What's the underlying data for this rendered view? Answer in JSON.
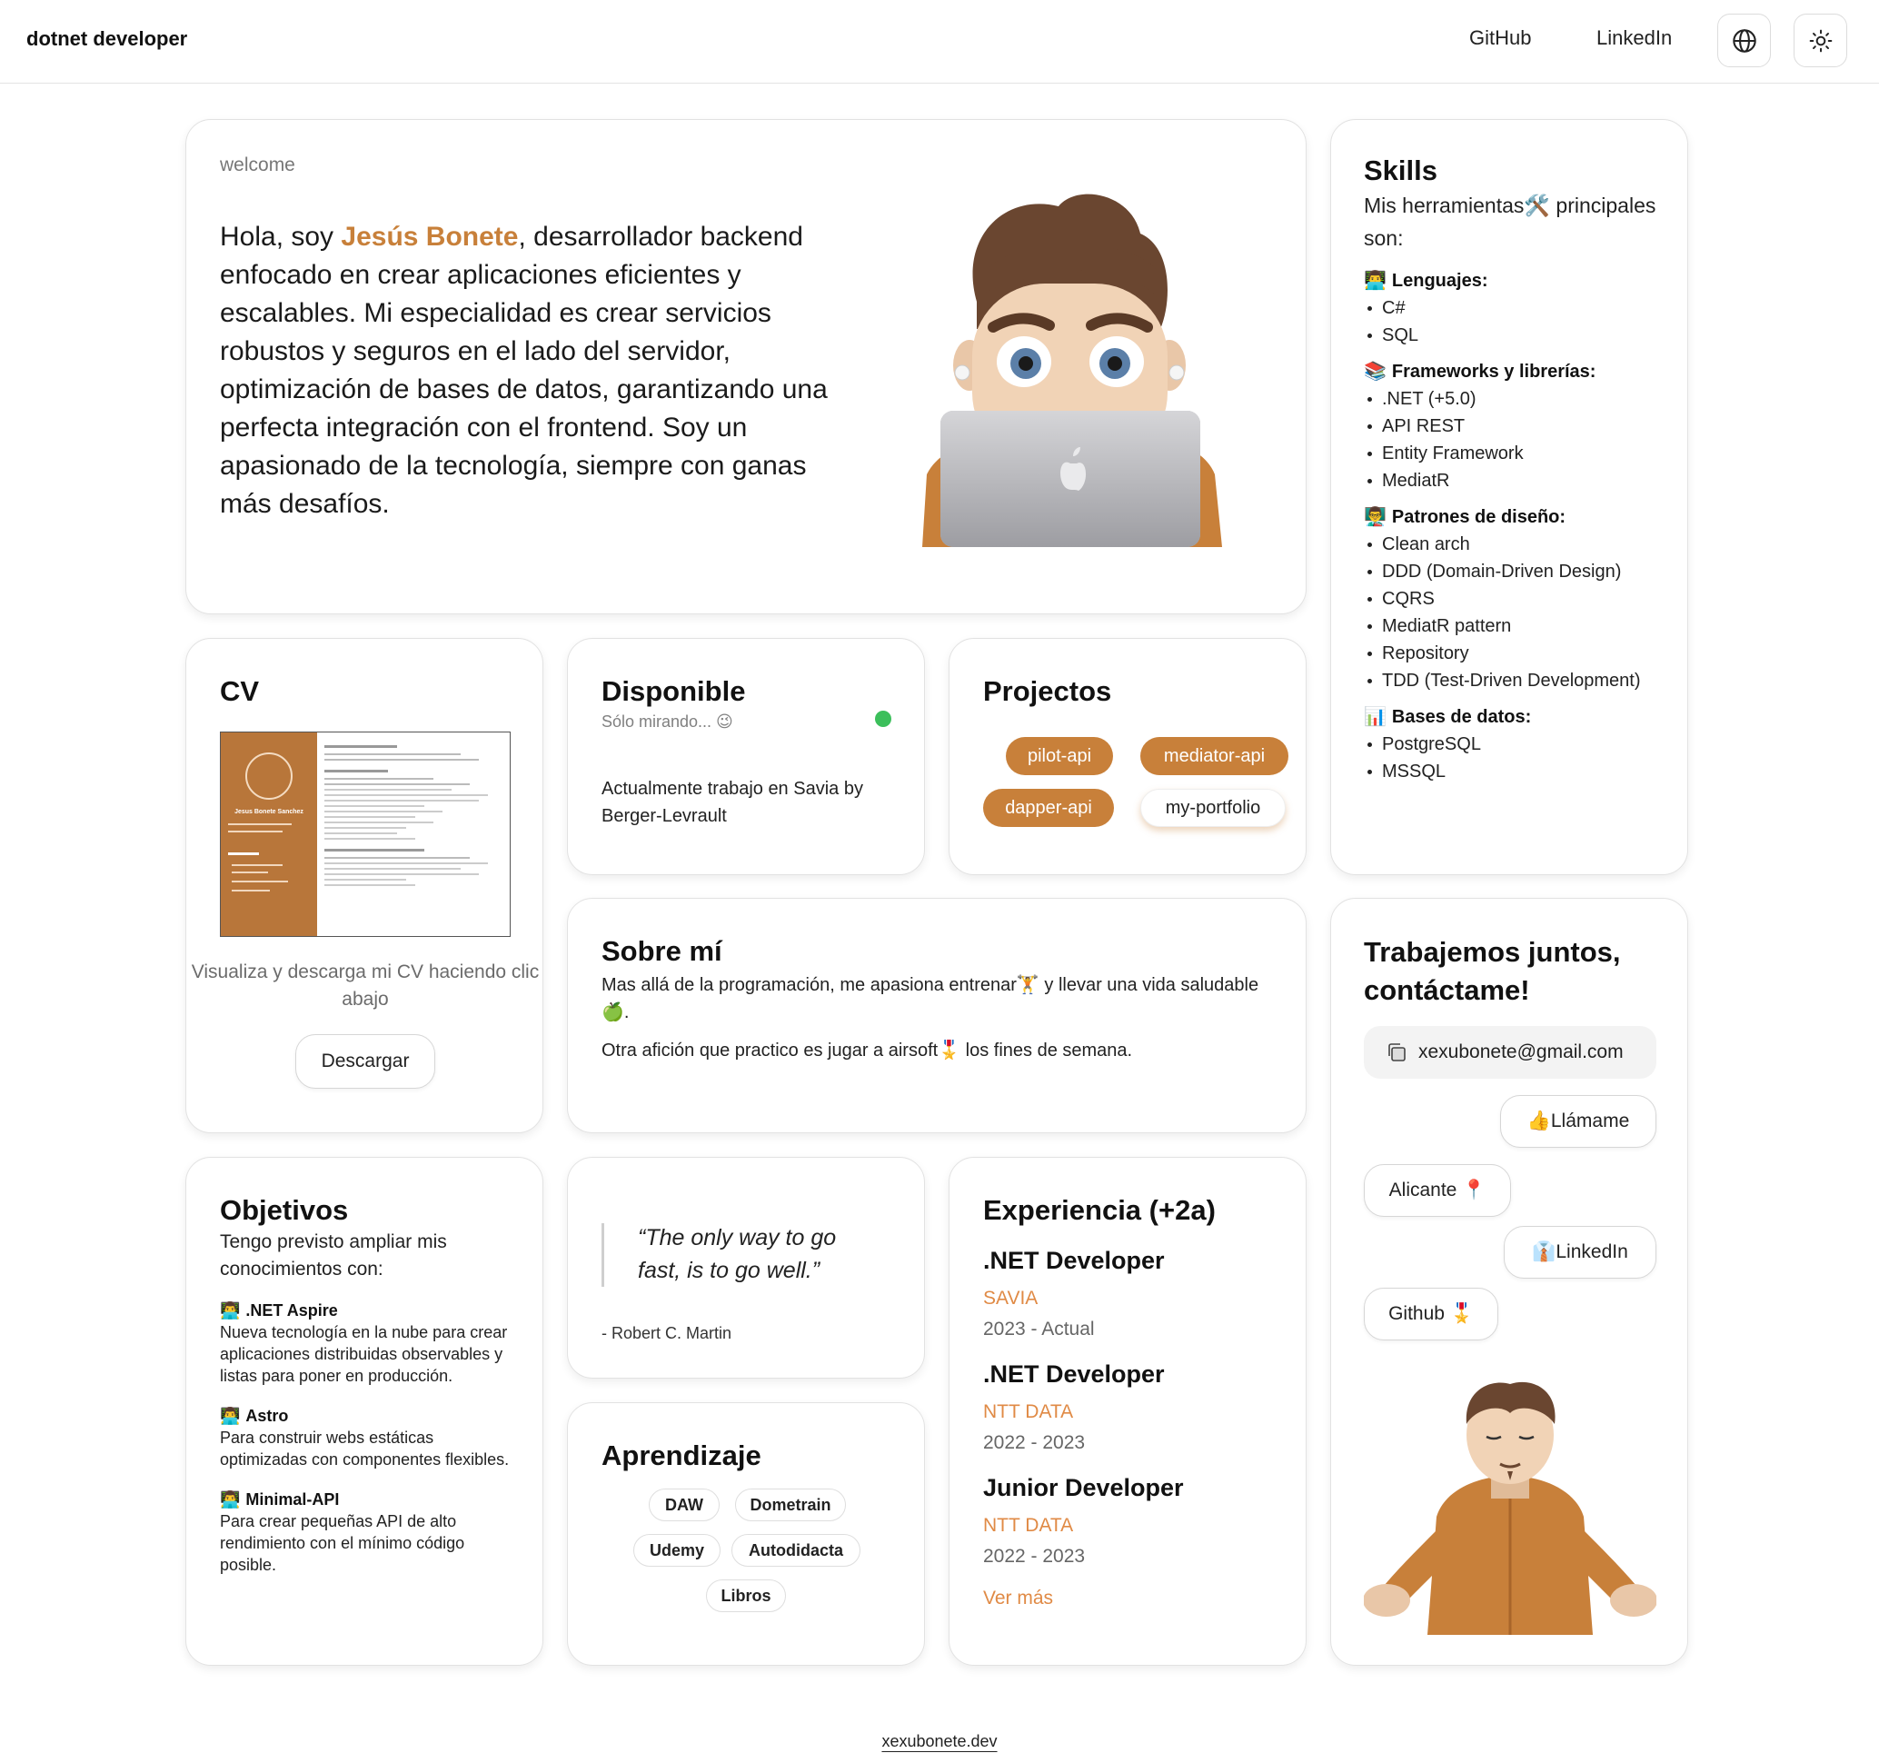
{
  "header": {
    "brand": "dotnet developer",
    "links": {
      "github": "GitHub",
      "linkedin": "LinkedIn"
    },
    "icons": {
      "language": "globe-icon",
      "theme": "sun-icon"
    }
  },
  "hero": {
    "eyebrow": "welcome",
    "intro_before": "Hola, soy ",
    "name": "Jesús Bonete",
    "intro_after": ", desarrollador backend enfocado en crear aplicaciones eficientes y escalables. Mi especialidad es crear servicios robustos y seguros en el lado del servidor, optimización de bases de datos, garantizando una perfecta integración con el frontend. Soy un apasionado de la tecnología, siempre con ganas más desafíos."
  },
  "skills": {
    "title": "Skills",
    "subtitle": "Mis herramientas🛠️ principales son:",
    "groups": [
      {
        "emoji": "👨‍💻",
        "title": "Lenguajes:",
        "items": [
          "C#",
          "SQL"
        ]
      },
      {
        "emoji": "📚",
        "title": "Frameworks y librerías:",
        "items": [
          ".NET (+5.0)",
          "API REST",
          "Entity Framework",
          "MediatR"
        ]
      },
      {
        "emoji": "👨‍🏫",
        "title": "Patrones de diseño:",
        "items": [
          "Clean arch",
          "DDD (Domain-Driven Design)",
          "CQRS",
          "MediatR pattern",
          "Repository",
          "TDD (Test-Driven Development)"
        ]
      },
      {
        "emoji": "📊",
        "title": "Bases de datos:",
        "items": [
          "PostgreSQL",
          "MSSQL"
        ]
      }
    ]
  },
  "cv": {
    "title": "CV",
    "thumb_name": "Jesus Bonete Sanchez",
    "caption": "Visualiza y descarga mi CV haciendo clic abajo",
    "button": "Descargar"
  },
  "available": {
    "title": "Disponible",
    "status": "Sólo mirando... 😉",
    "status_color": "#3cbf5b",
    "text": "Actualmente trabajo en Savia by Berger-Levrault"
  },
  "projects": {
    "title": "Projectos",
    "items": [
      "pilot-api",
      "mediator-api",
      "dapper-api",
      "my-portfolio"
    ]
  },
  "about": {
    "title": "Sobre mí",
    "p1": "Mas allá de la programación, me apasiona entrenar🏋️ y llevar una vida saludable🍏.",
    "p2": "Otra afición que practico es jugar a airsoft🎖️ los fines de semana."
  },
  "contact": {
    "title": "Trabajemos juntos, contáctame!",
    "email": "xexubonete@gmail.com",
    "call": "👍Llámame",
    "location": "Alicante 📍",
    "linkedin": "👔LinkedIn",
    "github": "Github 🎖️"
  },
  "goals": {
    "title": "Objetivos",
    "subtitle": "Tengo previsto ampliar mis conocimientos con:",
    "items": [
      {
        "emoji": "👨‍💻",
        "title": ".NET Aspire",
        "desc": "Nueva tecnología en la nube para crear aplicaciones distribuidas observables y listas para poner en producción."
      },
      {
        "emoji": "👨‍💻",
        "title": "Astro",
        "desc": "Para construir webs estáticas optimizadas con componentes flexibles."
      },
      {
        "emoji": "👨‍💻",
        "title": "Minimal-API",
        "desc": "Para crear pequeñas API de alto rendimiento con el mínimo código posible."
      }
    ]
  },
  "quote": {
    "text": "“The only way to go fast, is to go well.”",
    "author": "- Robert C. Martin"
  },
  "learning": {
    "title": "Aprendizaje",
    "items": [
      "DAW",
      "Dometrain",
      "Udemy",
      "Autodidacta",
      "Libros"
    ]
  },
  "experience": {
    "title": "Experiencia (+2a)",
    "jobs": [
      {
        "role": ".NET Developer",
        "company": "SAVIA",
        "dates": "2023 - Actual"
      },
      {
        "role": ".NET Developer",
        "company": "NTT DATA",
        "dates": "2022 - 2023"
      },
      {
        "role": "Junior Developer",
        "company": "NTT DATA",
        "dates": "2022 - 2023"
      }
    ],
    "more": "Ver más"
  },
  "footer": {
    "site": "xexubonete.dev"
  },
  "colors": {
    "accent": "#c8803a",
    "accent_text": "#e08a45",
    "available_dot": "#3cbf5b"
  }
}
